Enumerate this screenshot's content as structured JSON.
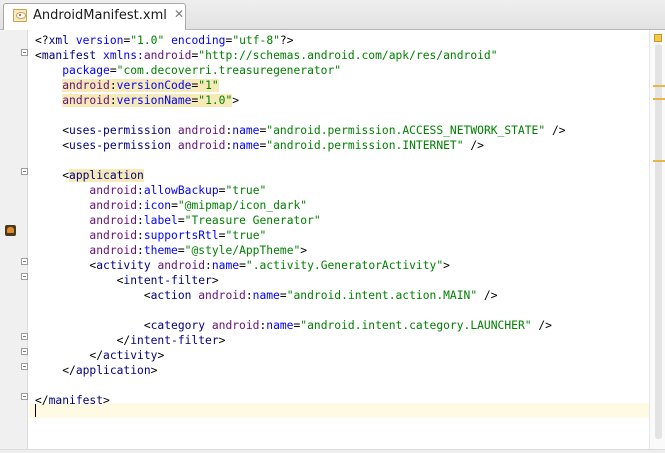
{
  "editor": {
    "tab": {
      "title": "AndroidManifest.xml",
      "close_glyph": "✕",
      "icon": "xml-file-icon"
    },
    "gutter_icon": "android-icon",
    "colors": {
      "tag": "#000080",
      "attribute": "#0000ff",
      "namespace_prefix": "#660e7a",
      "value": "#008000",
      "current_line": "#fffae3",
      "highlight": "#f6eab8",
      "warning_marker": "#e7b64a"
    },
    "lines": [
      [
        {
          "t": "<?",
          "c": "pi"
        },
        {
          "t": "xml ",
          "c": "tag"
        },
        {
          "t": "version",
          "c": "attr"
        },
        {
          "t": "=",
          "c": "pi"
        },
        {
          "t": "\"1.0\"",
          "c": "val"
        },
        {
          "t": " ",
          "c": "pi"
        },
        {
          "t": "encoding",
          "c": "attr"
        },
        {
          "t": "=",
          "c": "pi"
        },
        {
          "t": "\"utf-8\"",
          "c": "val"
        },
        {
          "t": "?>",
          "c": "pi"
        }
      ],
      [
        {
          "t": "<",
          "c": "pi"
        },
        {
          "t": "manifest ",
          "c": "tag"
        },
        {
          "t": "xmlns:",
          "c": "attr"
        },
        {
          "t": "android",
          "c": "ns"
        },
        {
          "t": "=",
          "c": "pi"
        },
        {
          "t": "\"http://schemas.android.com/apk/res/android\"",
          "c": "val"
        }
      ],
      [
        {
          "t": "    ",
          "c": "pi"
        },
        {
          "t": "package",
          "c": "attr"
        },
        {
          "t": "=",
          "c": "pi"
        },
        {
          "t": "\"com.decoverri.treasuregenerator\"",
          "c": "val"
        }
      ],
      [
        {
          "t": "    ",
          "c": "pi"
        },
        {
          "t": "android",
          "c": "ns hl"
        },
        {
          "t": ":",
          "c": "hl"
        },
        {
          "t": "versionCode",
          "c": "attr hl"
        },
        {
          "t": "=",
          "c": "hl"
        },
        {
          "t": "\"1\"",
          "c": "val hl"
        }
      ],
      [
        {
          "t": "    ",
          "c": "pi"
        },
        {
          "t": "android",
          "c": "ns hl"
        },
        {
          "t": ":",
          "c": "hl"
        },
        {
          "t": "versionName",
          "c": "attr hl"
        },
        {
          "t": "=",
          "c": "hl"
        },
        {
          "t": "\"1.0\"",
          "c": "val hl"
        },
        {
          "t": ">",
          "c": "pi"
        }
      ],
      [],
      [
        {
          "t": "    <",
          "c": "pi"
        },
        {
          "t": "uses-permission ",
          "c": "tag"
        },
        {
          "t": "android",
          "c": "ns"
        },
        {
          "t": ":",
          "c": "pi"
        },
        {
          "t": "name",
          "c": "attr"
        },
        {
          "t": "=",
          "c": "pi"
        },
        {
          "t": "\"android.permission.ACCESS_NETWORK_STATE\"",
          "c": "val"
        },
        {
          "t": " />",
          "c": "pi"
        }
      ],
      [
        {
          "t": "    <",
          "c": "pi"
        },
        {
          "t": "uses-permission ",
          "c": "tag"
        },
        {
          "t": "android",
          "c": "ns"
        },
        {
          "t": ":",
          "c": "pi"
        },
        {
          "t": "name",
          "c": "attr"
        },
        {
          "t": "=",
          "c": "pi"
        },
        {
          "t": "\"android.permission.INTERNET\"",
          "c": "val"
        },
        {
          "t": " />",
          "c": "pi"
        }
      ],
      [],
      [
        {
          "t": "    <",
          "c": "pi"
        },
        {
          "t": "application",
          "c": "tag hl"
        }
      ],
      [
        {
          "t": "        ",
          "c": "pi"
        },
        {
          "t": "android",
          "c": "ns"
        },
        {
          "t": ":",
          "c": "pi"
        },
        {
          "t": "allowBackup",
          "c": "attr"
        },
        {
          "t": "=",
          "c": "pi"
        },
        {
          "t": "\"true\"",
          "c": "val"
        }
      ],
      [
        {
          "t": "        ",
          "c": "pi"
        },
        {
          "t": "android",
          "c": "ns"
        },
        {
          "t": ":",
          "c": "pi"
        },
        {
          "t": "icon",
          "c": "attr"
        },
        {
          "t": "=",
          "c": "pi"
        },
        {
          "t": "\"@mipmap/icon_dark\"",
          "c": "val"
        }
      ],
      [
        {
          "t": "        ",
          "c": "pi"
        },
        {
          "t": "android",
          "c": "ns"
        },
        {
          "t": ":",
          "c": "pi"
        },
        {
          "t": "label",
          "c": "attr"
        },
        {
          "t": "=",
          "c": "pi"
        },
        {
          "t": "\"Treasure Generator\"",
          "c": "val"
        }
      ],
      [
        {
          "t": "        ",
          "c": "pi"
        },
        {
          "t": "android",
          "c": "ns"
        },
        {
          "t": ":",
          "c": "pi"
        },
        {
          "t": "supportsRtl",
          "c": "attr"
        },
        {
          "t": "=",
          "c": "pi"
        },
        {
          "t": "\"true\"",
          "c": "val"
        }
      ],
      [
        {
          "t": "        ",
          "c": "pi"
        },
        {
          "t": "android",
          "c": "ns"
        },
        {
          "t": ":",
          "c": "pi"
        },
        {
          "t": "theme",
          "c": "attr"
        },
        {
          "t": "=",
          "c": "pi"
        },
        {
          "t": "\"@style/AppTheme\"",
          "c": "val"
        },
        {
          "t": ">",
          "c": "pi"
        }
      ],
      [
        {
          "t": "        <",
          "c": "pi"
        },
        {
          "t": "activity ",
          "c": "tag"
        },
        {
          "t": "android",
          "c": "ns"
        },
        {
          "t": ":",
          "c": "pi"
        },
        {
          "t": "name",
          "c": "attr"
        },
        {
          "t": "=",
          "c": "pi"
        },
        {
          "t": "\".activity.GeneratorActivity\"",
          "c": "val"
        },
        {
          "t": ">",
          "c": "pi"
        }
      ],
      [
        {
          "t": "            <",
          "c": "pi"
        },
        {
          "t": "intent-filter",
          "c": "tag"
        },
        {
          "t": ">",
          "c": "pi"
        }
      ],
      [
        {
          "t": "                <",
          "c": "pi"
        },
        {
          "t": "action ",
          "c": "tag"
        },
        {
          "t": "android",
          "c": "ns"
        },
        {
          "t": ":",
          "c": "pi"
        },
        {
          "t": "name",
          "c": "attr"
        },
        {
          "t": "=",
          "c": "pi"
        },
        {
          "t": "\"android.intent.action.MAIN\"",
          "c": "val"
        },
        {
          "t": " />",
          "c": "pi"
        }
      ],
      [],
      [
        {
          "t": "                <",
          "c": "pi"
        },
        {
          "t": "category ",
          "c": "tag"
        },
        {
          "t": "android",
          "c": "ns"
        },
        {
          "t": ":",
          "c": "pi"
        },
        {
          "t": "name",
          "c": "attr"
        },
        {
          "t": "=",
          "c": "pi"
        },
        {
          "t": "\"android.intent.category.LAUNCHER\"",
          "c": "val"
        },
        {
          "t": " />",
          "c": "pi"
        }
      ],
      [
        {
          "t": "            </",
          "c": "pi"
        },
        {
          "t": "intent-filter",
          "c": "tag"
        },
        {
          "t": ">",
          "c": "pi"
        }
      ],
      [
        {
          "t": "        </",
          "c": "pi"
        },
        {
          "t": "activity",
          "c": "tag"
        },
        {
          "t": ">",
          "c": "pi"
        }
      ],
      [
        {
          "t": "    </",
          "c": "pi"
        },
        {
          "t": "application",
          "c": "tag"
        },
        {
          "t": ">",
          "c": "pi"
        }
      ],
      [],
      [
        {
          "t": "</",
          "c": "pi"
        },
        {
          "t": "manifest",
          "c": "tag"
        },
        {
          "t": ">",
          "c": "pi"
        }
      ],
      []
    ]
  }
}
